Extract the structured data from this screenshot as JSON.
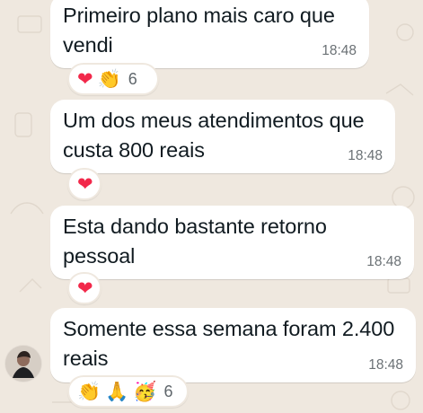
{
  "messages": [
    {
      "text": "Primeiro plano mais caro que\nvendi",
      "time": "18:48",
      "reactions": {
        "emojis": [
          "❤",
          "👏"
        ],
        "count": "6"
      }
    },
    {
      "text": "Um dos meus atendimentos que\ncusta 800 reais",
      "time": "18:48",
      "reactions": {
        "emojis": [
          "❤"
        ]
      }
    },
    {
      "text": "Esta dando bastante retorno\npessoal",
      "time": "18:48",
      "reactions": {
        "emojis": [
          "❤"
        ]
      }
    },
    {
      "text": "Somente essa semana foram 2.400\nreais",
      "time": "18:48",
      "reactions": {
        "emojis": [
          "👏",
          "🙏",
          "🥳"
        ],
        "count": "6"
      }
    }
  ],
  "colors": {
    "background": "#efe8df",
    "bubble": "#ffffff",
    "text": "#111b21",
    "timestamp": "#6b7175",
    "heart": "#f2284a"
  }
}
